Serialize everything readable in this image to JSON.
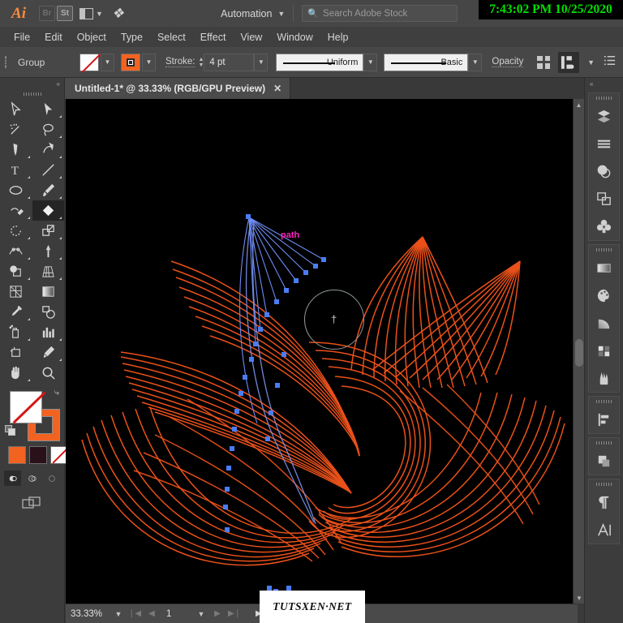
{
  "app": {
    "name": "Ai",
    "icons": [
      {
        "name": "bridge-icon",
        "label": "Br"
      },
      {
        "name": "stock-icon",
        "label": "St"
      }
    ],
    "arrange_label": "arrange-documents",
    "goto_label": "go-to-discover",
    "automation": "Automation",
    "search_placeholder": "Search Adobe Stock",
    "clock": "7:43:02 PM 10/25/2020",
    "clock_color": "#00e000"
  },
  "menus": [
    "File",
    "Edit",
    "Object",
    "Type",
    "Select",
    "Effect",
    "View",
    "Window",
    "Help"
  ],
  "control_bar": {
    "selection_label": "Group",
    "fill_label": "None",
    "stroke_color": "#f26322",
    "stroke_label": "Stroke:",
    "stroke_weight": "4 pt",
    "profile": "Uniform",
    "brush": "Basic",
    "opacity_label": "Opacity"
  },
  "document": {
    "tab_title": "Untitled-1* @ 33.33% (RGB/GPU Preview)",
    "close_label": "✕"
  },
  "tools": {
    "collapse": "«",
    "items": [
      {
        "name": "selection-tool",
        "glyph": "selection"
      },
      {
        "name": "direct-selection-tool",
        "glyph": "direct"
      },
      {
        "name": "magic-wand-tool",
        "glyph": "wand"
      },
      {
        "name": "lasso-tool",
        "glyph": "lasso"
      },
      {
        "name": "pen-tool",
        "glyph": "pen"
      },
      {
        "name": "curvature-tool",
        "glyph": "curvature"
      },
      {
        "name": "type-tool",
        "glyph": "type"
      },
      {
        "name": "line-segment-tool",
        "glyph": "line"
      },
      {
        "name": "ellipse-tool",
        "glyph": "ellipse"
      },
      {
        "name": "paintbrush-tool",
        "glyph": "brush"
      },
      {
        "name": "pencil-tool",
        "glyph": "pencil"
      },
      {
        "name": "shaper-eraser-tool",
        "glyph": "eraser",
        "selected": true
      },
      {
        "name": "rotate-tool",
        "glyph": "rotate"
      },
      {
        "name": "scale-tool",
        "glyph": "scale"
      },
      {
        "name": "width-tool",
        "glyph": "width"
      },
      {
        "name": "free-transform-tool",
        "glyph": "freetransform"
      },
      {
        "name": "shape-builder-tool",
        "glyph": "shapebuilder"
      },
      {
        "name": "perspective-grid-tool",
        "glyph": "perspective"
      },
      {
        "name": "mesh-tool",
        "glyph": "mesh"
      },
      {
        "name": "gradient-tool",
        "glyph": "gradient"
      },
      {
        "name": "eyedropper-tool",
        "glyph": "eyedropper"
      },
      {
        "name": "blend-tool",
        "glyph": "blend"
      },
      {
        "name": "symbol-sprayer-tool",
        "glyph": "sprayer"
      },
      {
        "name": "column-graph-tool",
        "glyph": "graph"
      },
      {
        "name": "artboard-tool",
        "glyph": "artboard"
      },
      {
        "name": "slice-tool",
        "glyph": "slice"
      },
      {
        "name": "hand-tool",
        "glyph": "hand"
      },
      {
        "name": "zoom-tool",
        "glyph": "zoom"
      }
    ],
    "swap_glyph": "⤷",
    "mode_swatches": [
      "#f26322",
      "#2a1018",
      "none"
    ]
  },
  "canvas": {
    "background": "#000000",
    "smart_guide_label": "path",
    "smart_guide_color": "#ff22c0",
    "artwork_stroke": "#f2541b",
    "selected_stroke": "#6f8cf5",
    "anchor_color": "#4a7df5"
  },
  "status_bar": {
    "zoom": "33.33%",
    "page": "1",
    "first_glyph": "❘◀",
    "prev_glyph": "◀",
    "next_glyph": "▶",
    "last_glyph": "▶❘"
  },
  "watermark": "TUTSXEN·NET",
  "right_dock": {
    "collapse": "«",
    "groups": [
      [
        "layers-panel",
        "properties-panel",
        "appearance-panel",
        "artboards-panel",
        "symbols-panel"
      ],
      [
        "gradient-panel",
        "color-panel",
        "stroke-panel",
        "swatches-panel",
        "brushes-panel"
      ],
      [
        "align-panel"
      ],
      [
        "pathfinder-panel"
      ],
      [
        "paragraph-panel",
        "character-panel"
      ]
    ]
  },
  "chart_data": null
}
